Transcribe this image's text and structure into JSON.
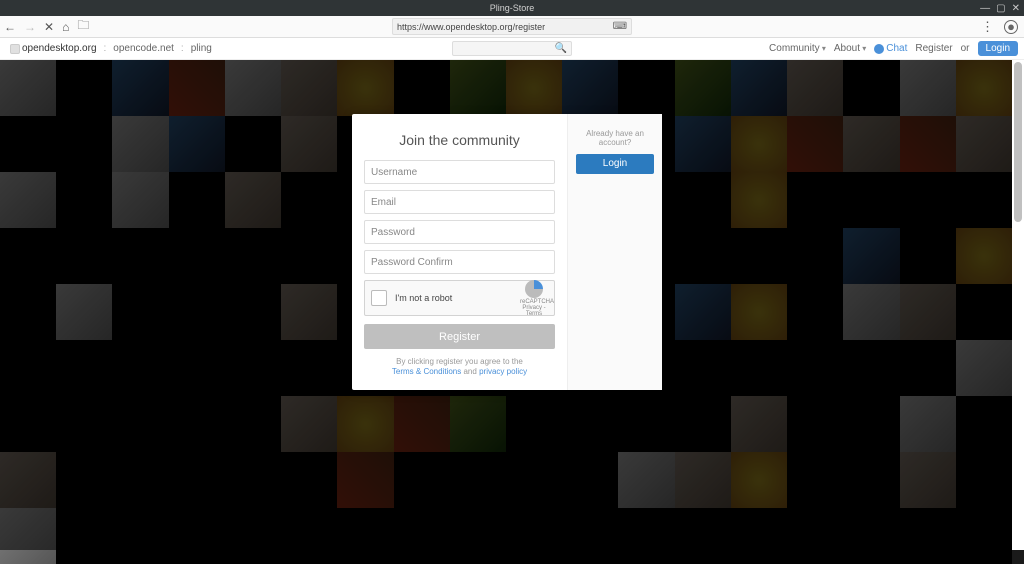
{
  "window": {
    "title": "Pling-Store"
  },
  "toolbar": {
    "url": "https://www.opendesktop.org/register"
  },
  "breadcrumbs": {
    "items": [
      {
        "label": "opendesktop.org"
      },
      {
        "label": "opencode.net"
      },
      {
        "label": "pling"
      }
    ]
  },
  "topmenu": {
    "community": "Community",
    "about": "About",
    "chat": "Chat",
    "register": "Register",
    "or": "or",
    "login": "Login"
  },
  "modal": {
    "heading": "Join the community",
    "username_ph": "Username",
    "email_ph": "Email",
    "password_ph": "Password",
    "confirm_ph": "Password Confirm",
    "recaptcha_label": "I'm not a robot",
    "recaptcha_brand": "reCAPTCHA",
    "recaptcha_sub": "Privacy - Terms",
    "register_btn": "Register",
    "agree_prefix": "By clicking register you agree to the",
    "terms": "Terms & Conditions",
    "and": "and",
    "privacy": "privacy policy",
    "already": "Already have an account?",
    "login_btn": "Login"
  }
}
